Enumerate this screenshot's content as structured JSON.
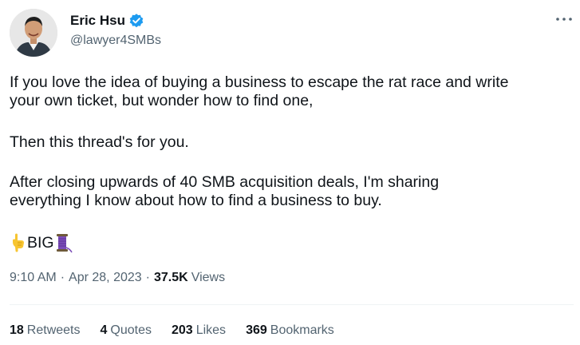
{
  "author": {
    "display_name": "Eric Hsu",
    "handle": "@lawyer4SMBs",
    "verified_icon": "verified-badge-icon",
    "avatar_icon": "profile-photo"
  },
  "more_icon": "more-options-icon",
  "tweet": {
    "line1": "If you love the idea of buying a business to escape the rat race and write",
    "line2": "your own ticket, but wonder how to find one,",
    "line3": "Then this thread's for you.",
    "line4": "After closing upwards of 40 SMB acquisition deals, I'm sharing",
    "line5": "everything I know about how to find a business to buy.",
    "big_text": "BIG",
    "emoji_left": "pointing-down-icon",
    "emoji_right": "thread-spool-icon"
  },
  "meta": {
    "time": "9:10 AM",
    "date": "Apr 28, 2023",
    "separator": "·",
    "views_count": "37.5K",
    "views_label": "Views"
  },
  "stats": [
    {
      "count": "18",
      "label": "Retweets"
    },
    {
      "count": "4",
      "label": "Quotes"
    },
    {
      "count": "203",
      "label": "Likes"
    },
    {
      "count": "369",
      "label": "Bookmarks"
    }
  ],
  "colors": {
    "text_primary": "#0f1419",
    "text_secondary": "#536471",
    "verified_blue": "#1d9bf0",
    "divider": "#eff3f4"
  }
}
